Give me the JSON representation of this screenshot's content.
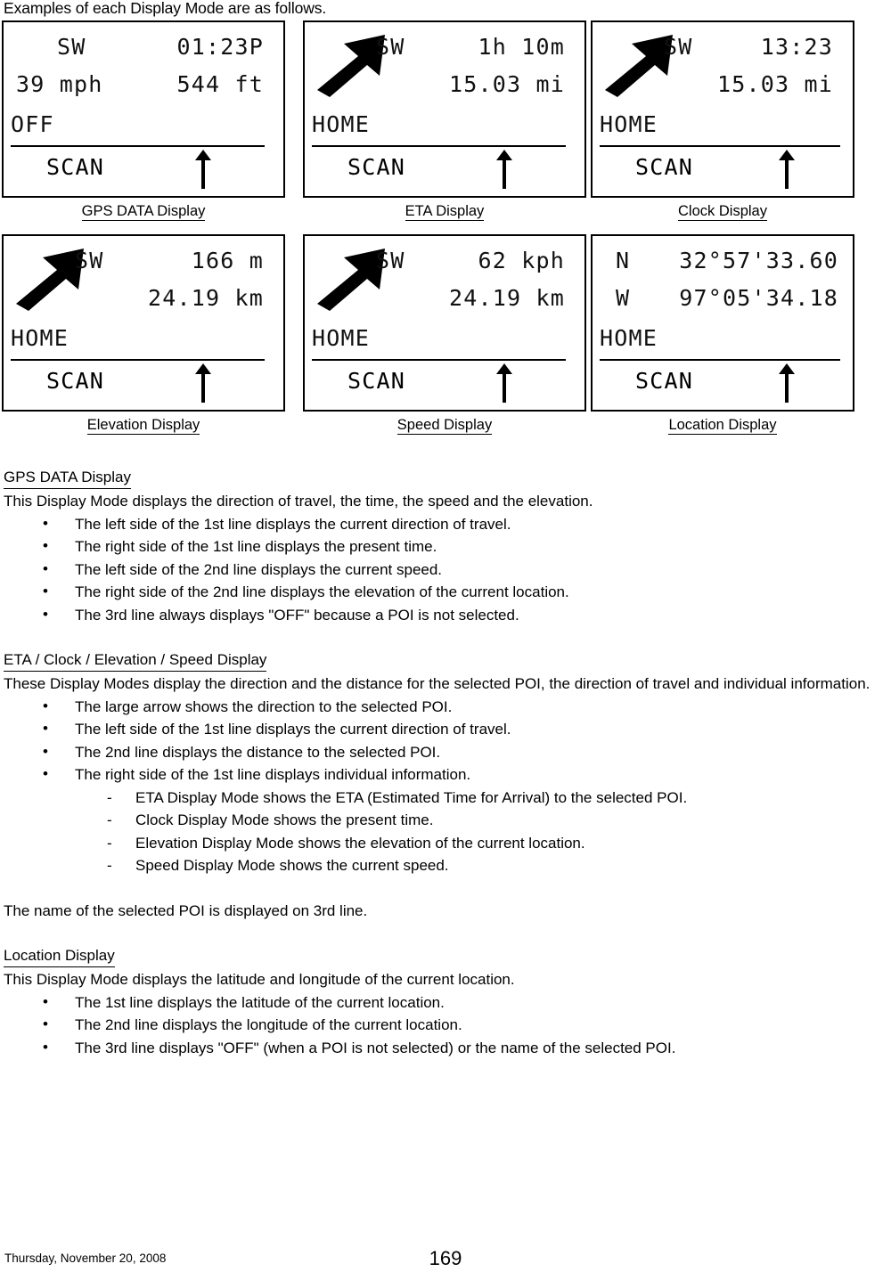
{
  "intro": "Examples of each Display Mode are as follows.",
  "panels": [
    {
      "id": "gps-data",
      "caption": "GPS DATA Display",
      "has_arrow": false,
      "line1_dir": "SW",
      "line1_right": "01:23P",
      "line2_left": "39 mph",
      "line2_right": "544 ft",
      "line3": "OFF",
      "scan": "SCAN"
    },
    {
      "id": "eta",
      "caption": "ETA Display",
      "has_arrow": true,
      "line1_dir": "SW",
      "line1_right": "1h 10m",
      "line2_left": "",
      "line2_right": "15.03 mi",
      "line3": "HOME",
      "scan": "SCAN"
    },
    {
      "id": "clock",
      "caption": "Clock Display",
      "has_arrow": true,
      "line1_dir": "SW",
      "line1_right": "13:23",
      "line2_left": "",
      "line2_right": "15.03 mi",
      "line3": "HOME",
      "scan": "SCAN"
    },
    {
      "id": "elevation",
      "caption": "Elevation Display",
      "has_arrow": true,
      "line1_dir": "SW",
      "line1_right": "166 m",
      "line2_left": "",
      "line2_right": "24.19 km",
      "line3": "HOME",
      "scan": "SCAN"
    },
    {
      "id": "speed",
      "caption": "Speed Display",
      "has_arrow": true,
      "line1_dir": "SW",
      "line1_right": "62 kph",
      "line2_left": "",
      "line2_right": "24.19 km",
      "line3": "HOME",
      "scan": "SCAN"
    },
    {
      "id": "location",
      "caption": "Location Display",
      "has_arrow": false,
      "line1_dir": "N",
      "line1_right": "32°57'33.60",
      "line2_left": "W",
      "line2_right": "97°05'34.18",
      "line3": "HOME",
      "scan": "SCAN"
    }
  ],
  "sections": {
    "gps": {
      "heading": "GPS DATA Display",
      "intro": "This Display Mode displays the direction of travel, the time, the speed and the elevation.",
      "bullets": [
        "The left side of the 1st line displays the current direction of travel.",
        "The right side of the 1st line displays the present time.",
        "The left side of the 2nd line displays the current speed.",
        "The right side of the 2nd line displays the elevation of the current location.",
        "The 3rd line always displays \"OFF\" because a POI is not selected."
      ]
    },
    "eta": {
      "heading": "ETA / Clock / Elevation / Speed Display",
      "intro": "These Display Modes display the direction and the distance for the selected POI, the direction of travel and individual information.",
      "bullets": [
        "The large arrow shows the direction to the selected POI.",
        "The left side of the 1st line displays the current direction of travel.",
        "The 2nd line displays the distance to the selected POI.",
        "The right side of the 1st line displays individual information."
      ],
      "subitems": [
        "ETA Display Mode shows the ETA (Estimated Time for Arrival) to the selected POI.",
        "Clock Display Mode shows the present time.",
        "Elevation Display Mode shows the elevation of the current location.",
        "Speed Display Mode shows the current speed."
      ],
      "closing": "The name of the selected POI is displayed on 3rd line."
    },
    "location": {
      "heading": "Location Display",
      "intro": "This Display Mode displays the latitude and longitude of the current location.",
      "bullets": [
        "The 1st line displays the latitude of the current location.",
        "The 2nd line displays the longitude of the current location.",
        "The 3rd line displays \"OFF\" (when a POI is not selected) or the name of the selected POI."
      ]
    }
  },
  "footer": {
    "date": "Thursday, November 20, 2008",
    "page": "169"
  }
}
